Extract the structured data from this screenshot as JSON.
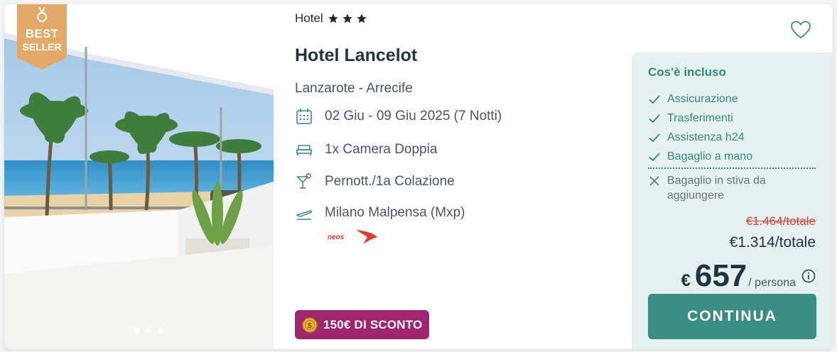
{
  "photo": {
    "badge": {
      "line1": "BEST",
      "line2": "SELLER"
    },
    "carousel_dots": 3,
    "carousel_active": 0
  },
  "hotel": {
    "category": "Hotel",
    "stars": 3,
    "name": "Hotel Lancelot",
    "location": "Lanzarote - Arrecife",
    "dates": "02 Giu - 09 Giu 2025 (7 Notti)",
    "room": "1x Camera Doppia",
    "board": "Pernott./1a Colazione",
    "departure": "Milano Malpensa (Mxp)",
    "airline_logo": "neos",
    "discount": "150€ DI SCONTO"
  },
  "included": {
    "title": "Cos'è incluso",
    "items": [
      "Assicurazione",
      "Trasferimenti",
      "Assistenza h24",
      "Bagaglio a mano"
    ],
    "excluded": [
      "Bagaglio in stiva da aggiungere"
    ]
  },
  "price": {
    "old_total": "€1.464/totale",
    "total": "€1.314/totale",
    "currency": "€",
    "per_person": "657",
    "per_person_label": "/ persona"
  },
  "cta": {
    "label": "CONTINUA"
  },
  "colors": {
    "accent": "#3a8d82",
    "included_text": "#2f8a7c",
    "panel_bg": "#e6f0ef",
    "discount_bg": "#a0246e",
    "badge_bg": "#e2aa66",
    "old_price": "#d0453a"
  }
}
